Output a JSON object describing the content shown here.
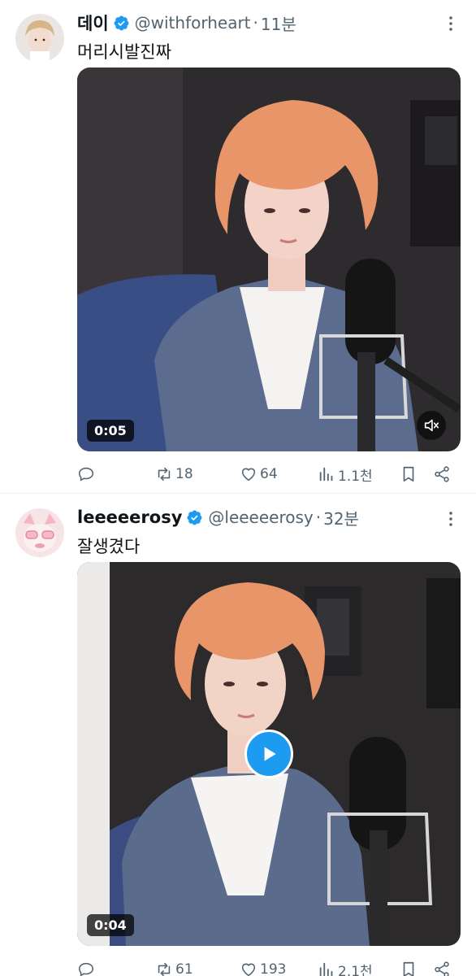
{
  "tweets": [
    {
      "display_name": "데이",
      "handle": "@withforheart",
      "separator": "·",
      "time": "11분",
      "text": "머리시발진짜",
      "duration": "0:05",
      "replies": "",
      "retweets": "18",
      "likes": "64",
      "views": "1.1천",
      "video_state": "muted"
    },
    {
      "display_name": "leeeeerosy",
      "handle": "@leeeeerosy",
      "separator": "·",
      "time": "32분",
      "text": "잘생겼다",
      "duration": "0:04",
      "replies": "",
      "retweets": "61",
      "likes": "193",
      "views": "2.1천",
      "video_state": "paused"
    }
  ],
  "colors": {
    "verified": "#1d9bf0",
    "secondary_text": "#536471",
    "play_button": "#1d9bf0",
    "hair": "#e8956a"
  },
  "icons": {
    "verified": "verified-badge-icon",
    "more": "more-icon",
    "reply": "reply-icon",
    "retweet": "retweet-icon",
    "like": "like-icon",
    "views": "views-icon",
    "bookmark": "bookmark-icon",
    "share": "share-icon",
    "mute": "muted-speaker-icon",
    "play": "play-icon"
  }
}
